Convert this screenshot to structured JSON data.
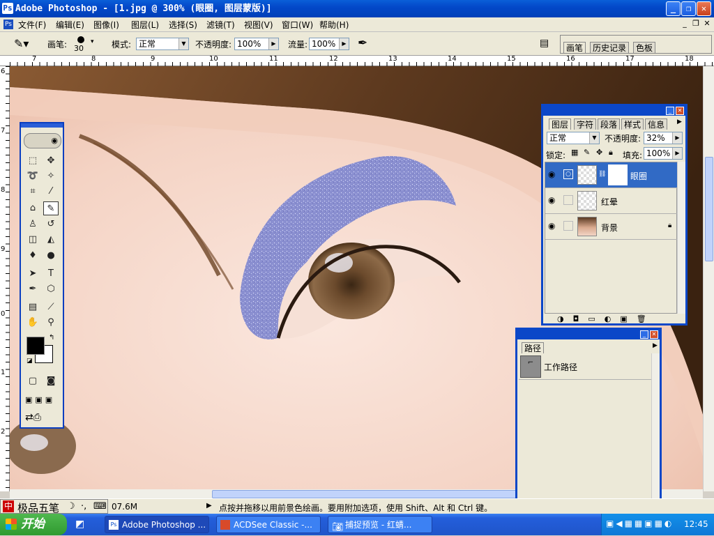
{
  "window": {
    "title": "Adobe Photoshop - [1.jpg @ 300% (眼圈, 图层蒙版)]",
    "controls": [
      "_",
      "❐",
      "✕"
    ]
  },
  "menu": [
    "文件(F)",
    "编辑(E)",
    "图像(I)",
    "图层(L)",
    "选择(S)",
    "滤镜(T)",
    "视图(V)",
    "窗口(W)",
    "帮助(H)"
  ],
  "options": {
    "brush_label": "画笔:",
    "brush_size": "30",
    "mode_label": "模式:",
    "mode_value": "正常",
    "opacity_label": "不透明度:",
    "opacity_value": "100%",
    "flow_label": "流量:",
    "flow_value": "100%",
    "palette_tabs": [
      "画笔",
      "历史记录",
      "色板"
    ]
  },
  "rulers": {
    "h_ticks": [
      "7",
      "8",
      "9",
      "10",
      "11",
      "12",
      "13",
      "14",
      "15",
      "16",
      "17",
      "18"
    ],
    "v_ticks": [
      "6",
      "7",
      "8",
      "9",
      "0",
      "1",
      "2"
    ]
  },
  "layers_panel": {
    "tabs": [
      "图层",
      "字符",
      "段落",
      "样式",
      "信息"
    ],
    "blend_mode": "正常",
    "opacity_label": "不透明度:",
    "opacity_value": "32%",
    "lock_label": "锁定:",
    "fill_label": "填充:",
    "fill_value": "100%",
    "layers": [
      {
        "name": "眼圈",
        "selected": true
      },
      {
        "name": "红晕",
        "selected": false
      },
      {
        "name": "背景",
        "selected": false
      }
    ]
  },
  "paths_panel": {
    "tab": "路径",
    "items": [
      "工作路径"
    ]
  },
  "status": {
    "ime": "极品五笔",
    "doc_size": "07.6M",
    "hint": "点按并拖移以用前景色绘画。要用附加选项，使用 Shift、Alt 和 Ctrl 键。"
  },
  "taskbar": {
    "start": "开始",
    "tasks": [
      "Adobe Photoshop ...",
      "ACDSee Classic -...",
      "捕捉预览 - 红蜻..."
    ],
    "clock": "12:45"
  },
  "colors": {
    "title_blue": "#0348c9",
    "eyeshadow": "#8a8fd0",
    "selected_layer": "#316ac5"
  }
}
